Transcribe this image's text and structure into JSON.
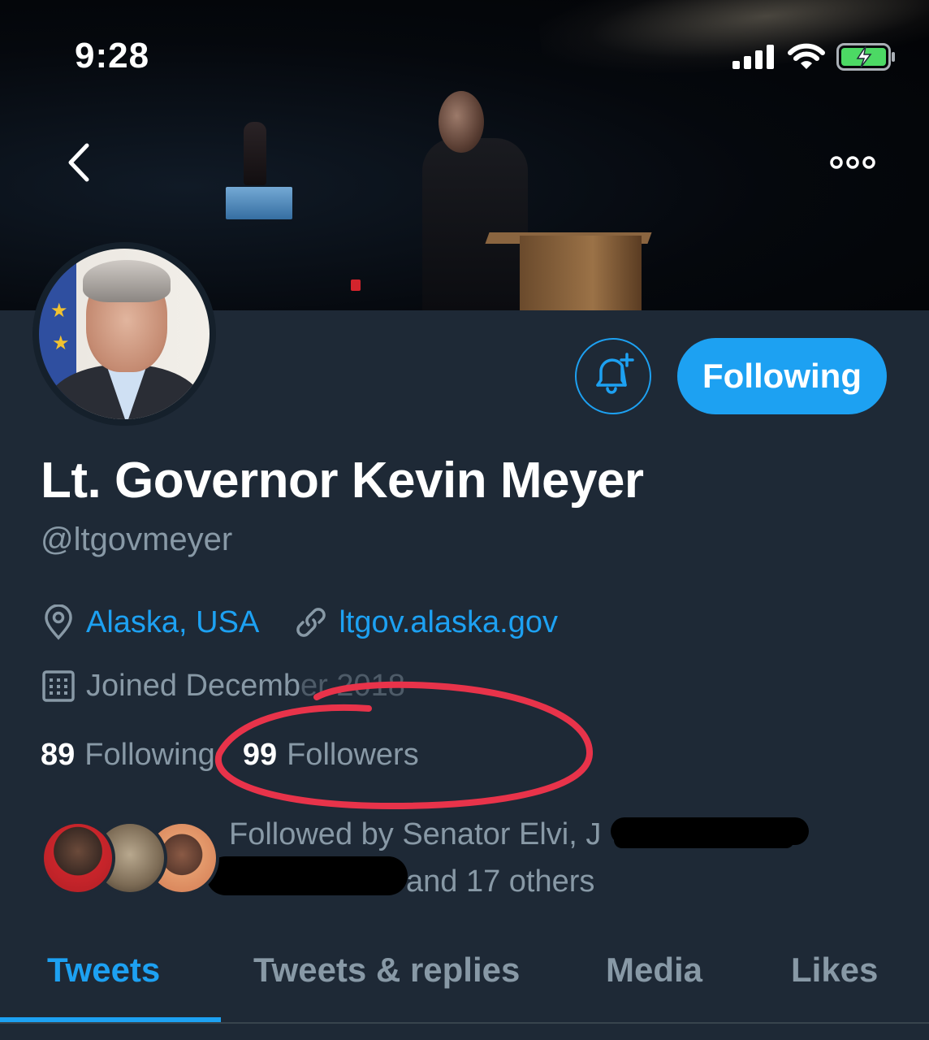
{
  "status_bar": {
    "time": "9:28",
    "icons": [
      "signal-icon",
      "wifi-icon",
      "battery-charging-icon"
    ]
  },
  "nav": {
    "back_icon": "chevron-left-icon",
    "more_icon": "more-horizontal-icon"
  },
  "profile": {
    "display_name": "Lt. Governor Kevin Meyer",
    "handle": "@ltgovmeyer",
    "location": "Alaska, USA",
    "website": "ltgov.alaska.gov",
    "joined": "Joined Decemb",
    "joined_obscured": "er 2018"
  },
  "actions": {
    "notify_icon": "bell-plus-icon",
    "following_label": "Following"
  },
  "stats": {
    "following_count": "89",
    "following_label": "Following",
    "followers_count": "99",
    "followers_label": "Followers"
  },
  "followed_by": {
    "line1": "Followed by Senator Elvi, J",
    "line2": "and 17 others"
  },
  "tabs": [
    {
      "label": "Tweets",
      "active": true
    },
    {
      "label": "Tweets & replies",
      "active": false
    },
    {
      "label": "Media",
      "active": false
    },
    {
      "label": "Likes",
      "active": false
    }
  ],
  "colors": {
    "accent": "#1da1f2",
    "background": "#1e2936",
    "muted": "#8899a6",
    "highlight": "#e8334a",
    "battery": "#4cd964"
  }
}
